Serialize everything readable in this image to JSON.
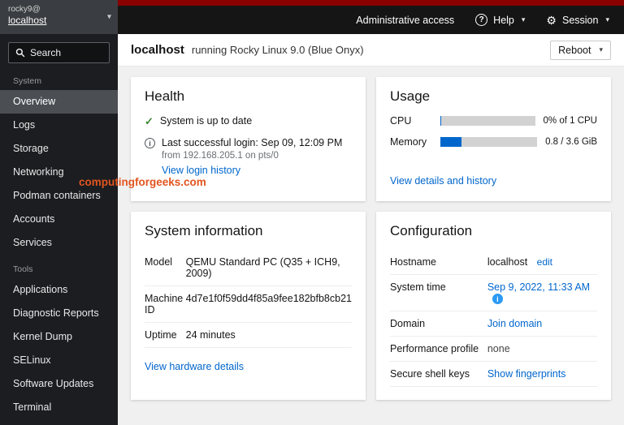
{
  "masthead": {
    "user_line1": "rocky9@",
    "user_line2": "localhost",
    "admin_access_label": "Administrative access",
    "help_label": "Help",
    "help_icon_glyph": "?",
    "session_label": "Session",
    "gear_icon_glyph": "⚙",
    "caret_glyph": "▾"
  },
  "sidebar": {
    "search_placeholder": "Search",
    "section1_label": "System",
    "section2_label": "Tools",
    "system_items": [
      "Overview",
      "Logs",
      "Storage",
      "Networking",
      "Podman containers",
      "Accounts",
      "Services"
    ],
    "tools_items": [
      "Applications",
      "Diagnostic Reports",
      "Kernel Dump",
      "SELinux",
      "Software Updates",
      "Terminal"
    ]
  },
  "header": {
    "hostname": "localhost",
    "subtitle": "running Rocky Linux 9.0 (Blue Onyx)",
    "reboot_label": "Reboot"
  },
  "watermark": "computingforgeeks.com",
  "health": {
    "title": "Health",
    "updates_status": "System is up to date",
    "check_glyph": "✓",
    "last_login": "Last successful login: Sep 09, 12:09 PM",
    "last_login_detail": "from 192.168.205.1 on pts/0",
    "login_history_link": "View login history"
  },
  "usage": {
    "title": "Usage",
    "cpu_label": "CPU",
    "cpu_value": "0% of 1 CPU",
    "cpu_percent": 1,
    "memory_label": "Memory",
    "memory_value": "0.8 / 3.6 GiB",
    "memory_percent": 22,
    "details_link": "View details and history"
  },
  "system_info": {
    "title": "System information",
    "rows": [
      {
        "label": "Model",
        "value": "QEMU Standard PC (Q35 + ICH9, 2009)"
      },
      {
        "label": "Machine ID",
        "value": "4d7e1f0f59dd4f85a9fee182bfb8cb21"
      },
      {
        "label": "Uptime",
        "value": "24 minutes"
      }
    ],
    "hardware_link": "View hardware details"
  },
  "configuration": {
    "title": "Configuration",
    "hostname_label": "Hostname",
    "hostname_value": "localhost",
    "hostname_edit": "edit",
    "time_label": "System time",
    "time_value": "Sep 9, 2022, 11:33 AM",
    "time_info_glyph": "i",
    "domain_label": "Domain",
    "domain_value": "Join domain",
    "profile_label": "Performance profile",
    "profile_value": "none",
    "ssh_label": "Secure shell keys",
    "ssh_value": "Show fingerprints"
  }
}
